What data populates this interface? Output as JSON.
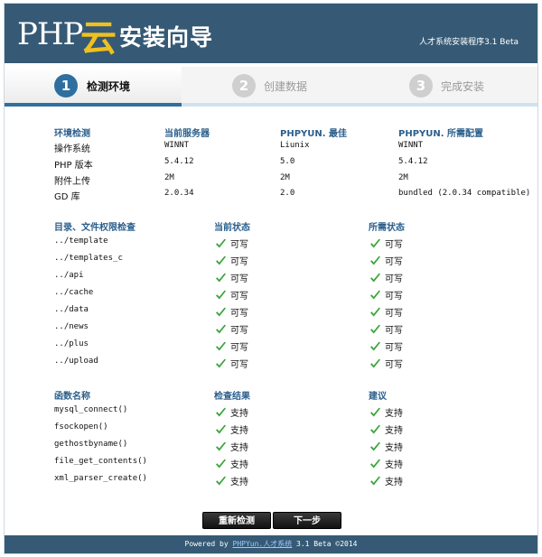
{
  "header": {
    "logo_php": "PHP",
    "logo_cloud": "云",
    "title": "安装向导",
    "version": "人才系统安装程序3.1 Beta"
  },
  "steps": [
    {
      "num": "1",
      "label": "检测环境",
      "active": true
    },
    {
      "num": "2",
      "label": "创建数据",
      "active": false
    },
    {
      "num": "3",
      "label": "完成安装",
      "active": false
    }
  ],
  "env": {
    "headers": [
      "环境检测",
      "当前服务器",
      "PHPYUN. 最佳",
      "PHPYUN. 所需配置"
    ],
    "rows": [
      {
        "name": "操作系统",
        "current": "WINNT",
        "best": "Liunix",
        "required": "WINNT"
      },
      {
        "name": "PHP 版本",
        "current": "5.4.12",
        "best": "5.0",
        "required": "5.4.12"
      },
      {
        "name": "附件上传",
        "current": "2M",
        "best": "2M",
        "required": "2M"
      },
      {
        "name": "GD 库",
        "current": "2.0.34",
        "best": "2.0",
        "required": "bundled (2.0.34 compatible)"
      }
    ]
  },
  "dirs": {
    "headers": [
      "目录、文件权限检查",
      "当前状态",
      "所需状态"
    ],
    "rows": [
      {
        "path": "../template",
        "current": "可写",
        "required": "可写"
      },
      {
        "path": "../templates_c",
        "current": "可写",
        "required": "可写"
      },
      {
        "path": "../api",
        "current": "可写",
        "required": "可写"
      },
      {
        "path": "../cache",
        "current": "可写",
        "required": "可写"
      },
      {
        "path": "../data",
        "current": "可写",
        "required": "可写"
      },
      {
        "path": "../news",
        "current": "可写",
        "required": "可写"
      },
      {
        "path": "../plus",
        "current": "可写",
        "required": "可写"
      },
      {
        "path": "../upload",
        "current": "可写",
        "required": "可写"
      }
    ]
  },
  "funcs": {
    "headers": [
      "函数名称",
      "检查结果",
      "建议"
    ],
    "rows": [
      {
        "name": "mysql_connect()",
        "result": "支持",
        "advice": "支持"
      },
      {
        "name": "fsockopen()",
        "result": "支持",
        "advice": "支持"
      },
      {
        "name": "gethostbyname()",
        "result": "支持",
        "advice": "支持"
      },
      {
        "name": "file_get_contents()",
        "result": "支持",
        "advice": "支持"
      },
      {
        "name": "xml_parser_create()",
        "result": "支持",
        "advice": "支持"
      }
    ]
  },
  "buttons": {
    "recheck": "重新检测",
    "next": "下一步"
  },
  "footer": {
    "prefix": "Powered by ",
    "link": "PHPYun.人才系统",
    "suffix": " 3.1 Beta ©2014"
  },
  "colors": {
    "header_bg": "#365a75",
    "section_head": "#2b5f8c",
    "check_green": "#3aa63a",
    "step_active": "#2f6f9f",
    "step_inactive": "#cfcfcf"
  }
}
